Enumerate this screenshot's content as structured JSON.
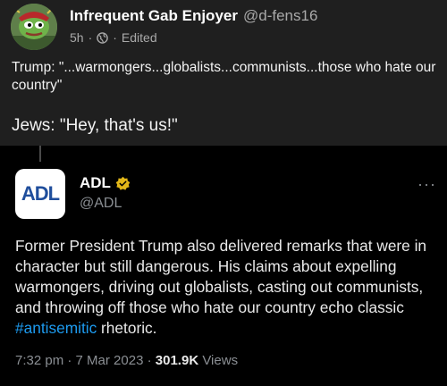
{
  "post": {
    "author_name": "Infrequent Gab Enjoyer",
    "author_handle": "@d-fens16",
    "time": "5h",
    "visibility_icon": "globe-icon",
    "edited_label": "Edited",
    "text_line1": "Trump: \"...warmongers...globalists...communists...those who hate our country\"",
    "text_line2": "Jews: \"Hey, that's us!\""
  },
  "embedded_tweet": {
    "author_name": "ADL",
    "author_handle": "@ADL",
    "avatar_text": "ADL",
    "verified_badge_icon": "gold-verified-badge-icon",
    "more_icon": "more-options-icon",
    "text_before_hashtag": "Former President Trump also delivered remarks that were in character but still dangerous. His claims about expelling warmongers, driving out globalists, casting out communists, and throwing off those who hate our country echo classic ",
    "hashtag": "#antisemitic",
    "text_after_hashtag": " rhetoric.",
    "time": "7:32 pm",
    "date": "7 Mar 2023",
    "views_count": "301.9K",
    "views_label": "Views"
  },
  "colors": {
    "outer_bg": "#1f1f1f",
    "inner_bg": "#000000",
    "hashtag": "#1d9bf0",
    "badge_gold": "#e2b719",
    "adl_blue": "#1f4e9c"
  }
}
